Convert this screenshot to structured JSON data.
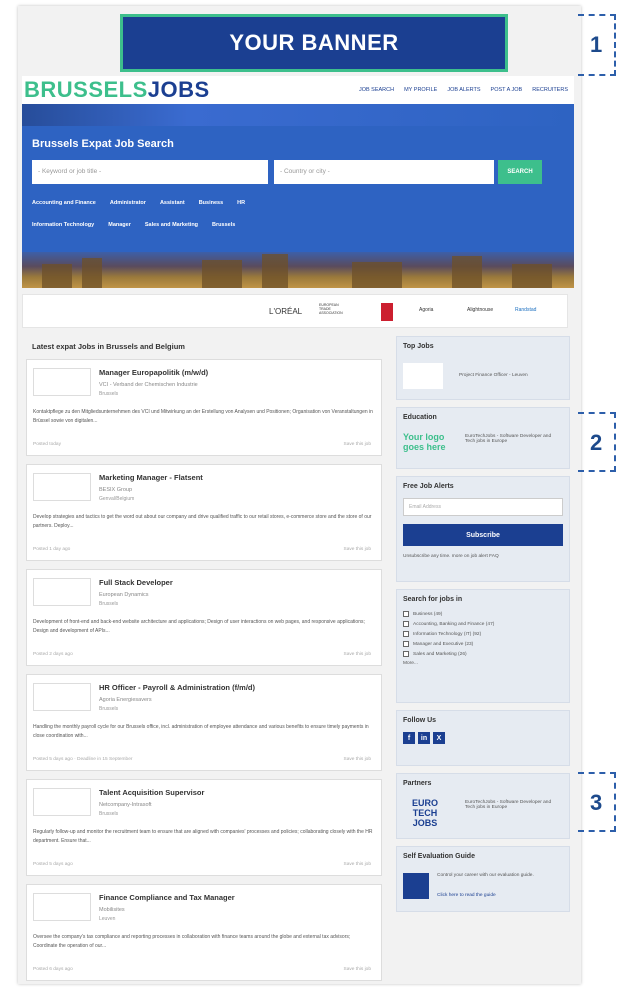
{
  "banner": {
    "text": "YOUR BANNER"
  },
  "callouts": [
    "1",
    "2",
    "3"
  ],
  "logo": {
    "part1": "BRUSSELS",
    "part2": "JOBS"
  },
  "nav": [
    "JOB SEARCH",
    "MY PROFILE",
    "JOB ALERTS",
    "POST A JOB",
    "RECRUITERS"
  ],
  "hero": {
    "title": "Brussels Expat Job Search",
    "keyword_placeholder": "- Keyword or job title -",
    "location_placeholder": "- Country or city -",
    "search_label": "SEARCH",
    "categories_row1": [
      "Accounting and Finance",
      "Administrator",
      "Assistant",
      "Business",
      "HR"
    ],
    "categories_row2": [
      "Information Technology",
      "Manager",
      "Sales and Marketing",
      "Brussels"
    ]
  },
  "partners_strip": [
    "L'ORÉAL",
    "EUROPEAN TRADE ASSOCIATION",
    "Agoria",
    "Alightnouse",
    "Randstad"
  ],
  "main": {
    "section_title": "Latest expat Jobs in Brussels and Belgium",
    "save_label": "Save this job",
    "jobs": [
      {
        "title": "Manager Europapolitik (m/w/d)",
        "company": "VCI - Verband der Chemischen Industrie",
        "location": "Brussels",
        "desc": "Kontaktpflege zu den Mitgliedsunternehmen des VCI und Mitwirkung an der Erstellung von Analysen und Positionen; Organisation von Veranstaltungen in Brüssel sowie von digitalen...",
        "posted": "Posted today"
      },
      {
        "title": "Marketing Manager - Flatsent",
        "company": "BESIX Group",
        "location": "Genval/Belgium",
        "desc": "Develop strategies and tactics to get the word out about our company and drive qualified traffic to our retail stores, e-commerce store and the store of our partners. Deploy...",
        "posted": "Posted 1 day ago"
      },
      {
        "title": "Full Stack Developer",
        "company": "European Dynamics",
        "location": "Brussels",
        "desc": "Development of front-end and back-end website architecture and applications; Design of user interactions on web pages, and responsive applications; Design and development of APIs...",
        "posted": "Posted 2 days ago"
      },
      {
        "title": "HR Officer - Payroll & Administration (f/m/d)",
        "company": "Agoria Energiesavers",
        "location": "Brussels",
        "desc": "Handling the monthly payroll cycle for our Brussels office, incl. administration of employee attendance and various benefits to ensure timely payments in close coordination with...",
        "posted": "Posted 5 days ago · Deadline in 15 September"
      },
      {
        "title": "Talent Acquisition Supervisor",
        "company": "Netcompany-Intrasoft",
        "location": "Brussels",
        "desc": "Regularly follow-up and monitor the recruitment team to ensure that are aligned with companies' processes and policies; collaborating closely with the HR department. Ensure that...",
        "posted": "Posted 5 days ago"
      },
      {
        "title": "Finance Compliance and Tax Manager",
        "company": "Mobilisites",
        "location": "Leuven",
        "desc": "Oversee the company's tax compliance and reporting processes in collaboration with finance teams around the globe and external tax advisors; Coordinate the operation of our...",
        "posted": "Posted 6 days ago"
      }
    ]
  },
  "sidebar": {
    "top_jobs_title": "Top Jobs",
    "top_job_text": "Project Finance Officer - Leuven",
    "education_title": "Education",
    "your_logo": "Your logo goes here",
    "edu_text": "EuroTechJobs - Software Developer and Tech jobs in Europe",
    "alerts_title": "Free Job Alerts",
    "email_placeholder": "Email Address",
    "subscribe_label": "Subscribe",
    "unsubscribe_text": "Unsubscribe any time. more on job alert FAQ",
    "search_title": "Search for jobs in",
    "search_items": [
      "Business (49)",
      "Accounting, Banking and Finance (47)",
      "Information Technology (IT) (92)",
      "Manager and Executive (23)",
      "Sales and Marketing (26)"
    ],
    "more_label": "More...",
    "follow_title": "Follow Us",
    "partners_title": "Partners",
    "partners_logo": "EURO TECH JOBS",
    "partners_text": "EuroTechJobs - Software Developer and Tech jobs in Europe",
    "guide_title": "Self Evaluation Guide",
    "guide_text": "Control your career with our evaluation guide.",
    "guide_link": "Click here to read the guide"
  }
}
